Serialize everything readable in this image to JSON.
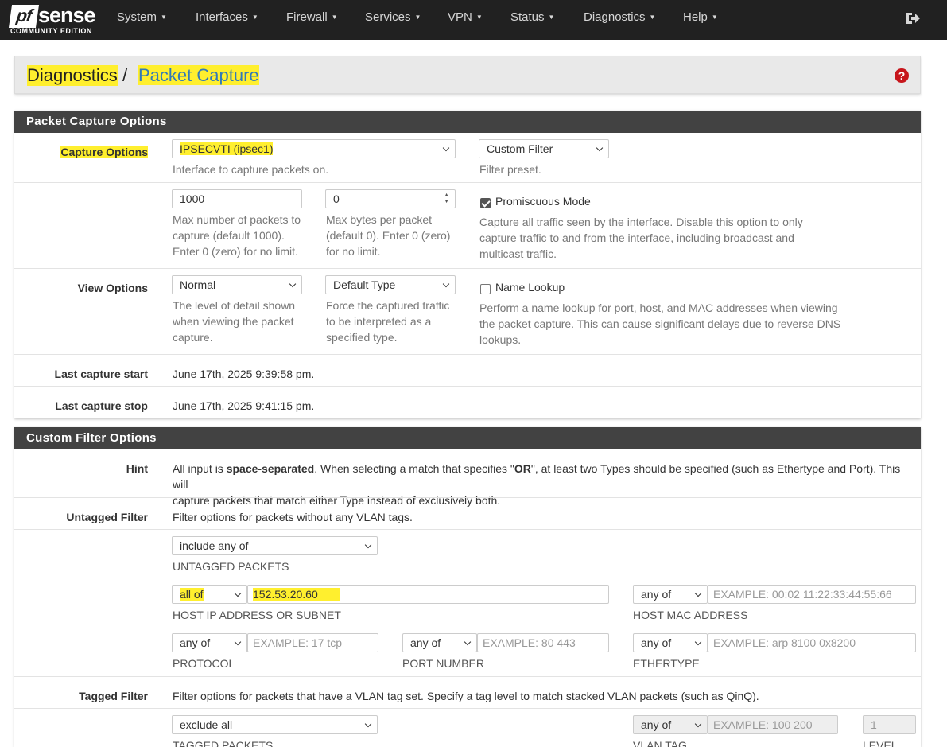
{
  "brand": {
    "name_pf": "pf",
    "name_sense": "sense",
    "edition": "COMMUNITY EDITION"
  },
  "nav": {
    "items": [
      {
        "label": "System"
      },
      {
        "label": "Interfaces"
      },
      {
        "label": "Firewall"
      },
      {
        "label": "Services"
      },
      {
        "label": "VPN"
      },
      {
        "label": "Status"
      },
      {
        "label": "Diagnostics"
      },
      {
        "label": "Help"
      }
    ],
    "logout_icon": "sign-out-icon"
  },
  "breadcrumb": {
    "root": "Diagnostics",
    "separator": "/",
    "current": "Packet Capture",
    "help_icon": "question-circle-icon"
  },
  "highlight_color": "#ffef2e",
  "capture_options": {
    "title": "Packet Capture Options",
    "capture_label": "Capture Options",
    "interface_value": "IPSECVTI (ipsec1)",
    "interface_help": "Interface to capture packets on.",
    "filter_value": "Custom Filter",
    "filter_help": "Filter preset.",
    "max_packets_value": "1000",
    "max_packets_help": "Max number of packets to capture (default 1000). Enter 0 (zero) for no limit.",
    "max_bytes_value": "0",
    "max_bytes_help": "Max bytes per packet (default 0). Enter 0 (zero) for no limit.",
    "promiscuous_label": "Promiscuous Mode",
    "promiscuous_checked": true,
    "promiscuous_help": "Capture all traffic seen by the interface. Disable this option to only capture traffic to and from the interface, including broadcast and multicast traffic.",
    "view_label": "View Options",
    "detail_value": "Normal",
    "detail_help": "The level of detail shown when viewing the packet capture.",
    "type_value": "Default Type",
    "type_help": "Force the captured traffic to be interpreted as a specified type.",
    "name_lookup_label": "Name Lookup",
    "name_lookup_checked": false,
    "name_lookup_help": "Perform a name lookup for port, host, and MAC addresses when viewing the packet capture. This can cause significant delays due to reverse DNS lookups.",
    "last_start_label": "Last capture start",
    "last_start_value": "June 17th, 2025 9:39:58 pm.",
    "last_stop_label": "Last capture stop",
    "last_stop_value": "June 17th, 2025 9:41:15 pm."
  },
  "custom_filter": {
    "title": "Custom Filter Options",
    "hint_label": "Hint",
    "hint_pre": "All input is ",
    "hint_bold": "space-separated",
    "hint_mid": ". When selecting a match that specifies \"",
    "hint_or": "OR",
    "hint_post": "\", at least two Types should be specified (such as Ethertype and Port). This will",
    "hint_line2": "capture packets that match either Type instead of exclusively both.",
    "untagged_label": "Untagged Filter",
    "untagged_help": "Filter options for packets without any VLAN tags.",
    "untagged_mode": "include any of",
    "untagged_caption": "UNTAGGED PACKETS",
    "host_match": "all of",
    "host_value": "152.53.20.60",
    "host_caption": "HOST IP ADDRESS OR SUBNET",
    "mac_match": "any of",
    "mac_placeholder": "EXAMPLE: 00:02 11:22:33:44:55:66",
    "mac_caption": "HOST MAC ADDRESS",
    "proto_match": "any of",
    "proto_placeholder": "EXAMPLE: 17 tcp",
    "proto_caption": "PROTOCOL",
    "port_match": "any of",
    "port_placeholder": "EXAMPLE: 80 443",
    "port_caption": "PORT NUMBER",
    "ether_match": "any of",
    "ether_placeholder": "EXAMPLE: arp 8100 0x8200",
    "ether_caption": "ETHERTYPE",
    "tagged_label": "Tagged Filter",
    "tagged_help": "Filter options for packets that have a VLAN tag set. Specify a tag level to match stacked VLAN packets (such as QinQ).",
    "tagged_mode": "exclude all",
    "tagged_caption": "TAGGED PACKETS",
    "vlan_match": "any of",
    "vlan_placeholder": "EXAMPLE: 100 200",
    "vlan_caption": "VLAN TAG",
    "level_value": "1",
    "level_caption": "LEVEL"
  }
}
